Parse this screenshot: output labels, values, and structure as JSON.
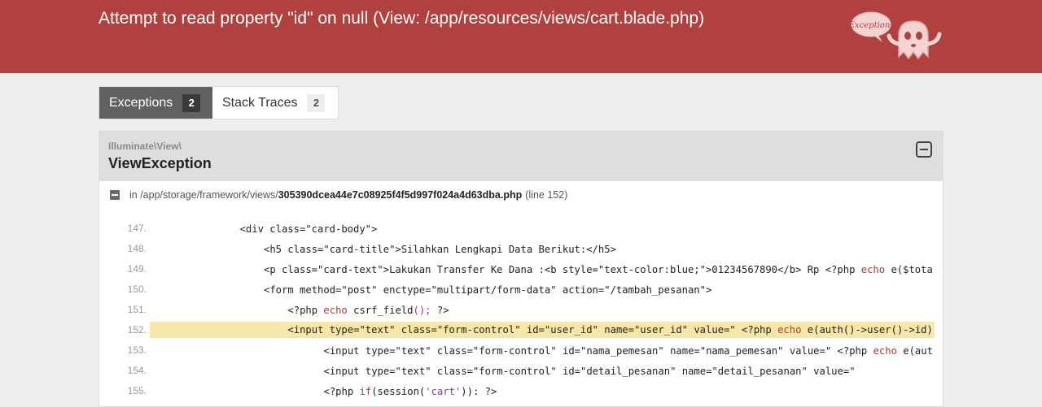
{
  "header": {
    "title": "Attempt to read property \"id\" on null (View: /app/resources/views/cart.blade.php)",
    "mascot_label": "Exception!"
  },
  "tabs": [
    {
      "label": "Exceptions",
      "count": "2",
      "active": true
    },
    {
      "label": "Stack Traces",
      "count": "2",
      "active": false
    }
  ],
  "exception": {
    "namespace": "Illuminate\\View\\",
    "name": "ViewException",
    "file_prefix": "in /app/storage/framework/views/",
    "file_name": "305390dcea44e7c08925f4f5d997f024a4d63dba.php",
    "file_line": "(line 152)"
  },
  "code_lines": [
    {
      "num": "147.",
      "indent": 16,
      "parts": [
        {
          "t": "<div class=\"card-body\">"
        }
      ]
    },
    {
      "num": "148.",
      "indent": 20,
      "parts": [
        {
          "t": "<h5 class=\"card-title\">Silahkan Lengkapi Data Berikut:</h5>"
        }
      ]
    },
    {
      "num": "149.",
      "indent": 20,
      "parts": [
        {
          "t": "<p class=\"card-text\">Lakukan Transfer Ke Dana :<b style=\"text-color:blue;\">01234567890</b> Rp <?php "
        },
        {
          "t": "echo",
          "c": "kw"
        },
        {
          "t": " e($tota"
        }
      ]
    },
    {
      "num": "150.",
      "indent": 20,
      "parts": [
        {
          "t": "<form method=\"post\" enctype=\"multipart/form-data\" action=\"/tambah_pesanan\">"
        }
      ]
    },
    {
      "num": "151.",
      "indent": 24,
      "parts": [
        {
          "t": "<?php "
        },
        {
          "t": "echo",
          "c": "kw"
        },
        {
          "t": " csrf_field"
        },
        {
          "t": "();",
          "c": "kw"
        },
        {
          "t": " ?>"
        }
      ]
    },
    {
      "num": "152.",
      "indent": 24,
      "hl": true,
      "parts": [
        {
          "t": "<input type=\"text\" class=\"form-control\" id=\"user_id\" name=\"user_id\" value=\" <?php "
        },
        {
          "t": "echo",
          "c": "kw"
        },
        {
          "t": " e(auth()->user()->id)"
        }
      ]
    },
    {
      "num": "153.",
      "indent": 30,
      "parts": [
        {
          "t": "<input type=\"text\" class=\"form-control\" id=\"nama_pemesan\" name=\"nama_pemesan\" value=\" <?php "
        },
        {
          "t": "echo",
          "c": "kw"
        },
        {
          "t": " e(aut"
        }
      ]
    },
    {
      "num": "154.",
      "indent": 30,
      "parts": [
        {
          "t": "<input type=\"text\" class=\"form-control\" id=\"detail_pesanan\" name=\"detail_pesanan\" value=\""
        }
      ]
    },
    {
      "num": "155.",
      "indent": 30,
      "parts": [
        {
          "t": "<?php "
        },
        {
          "t": "if",
          "c": "kw"
        },
        {
          "t": "(session("
        },
        {
          "t": "'cart'",
          "c": "str"
        },
        {
          "t": ")): ?>"
        }
      ]
    }
  ]
}
